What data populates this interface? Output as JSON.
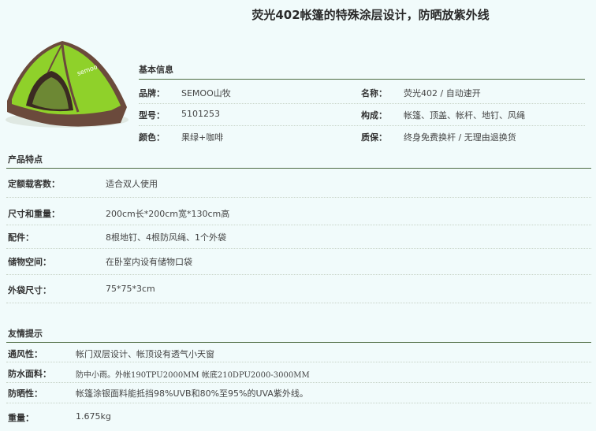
{
  "title": "荧光402帐篷的特殊涂层设计，防晒放紫外线",
  "basic_info": {
    "heading": "基本信息",
    "rows": [
      {
        "k1": "品牌：",
        "v1": "SEMOO山牧",
        "k2": "名称：",
        "v2": "荧光402 / 自动速开"
      },
      {
        "k1": "型号：",
        "v1": "5101253",
        "k2": "构成：",
        "v2": "帐篷、顶盖、帐杆、地钉、风绳"
      },
      {
        "k1": "颜色：",
        "v1": "果绿+咖啡",
        "k2": "质保：",
        "v2": "终身免费换杆 / 无理由退换货"
      }
    ]
  },
  "features": {
    "heading": "产品特点",
    "rows": [
      {
        "key": "定额载客数：",
        "value": "适合双人使用"
      },
      {
        "key": "尺寸和重量：",
        "value": "200cm长*200cm宽*130cm高"
      },
      {
        "key": "配件：",
        "value": "8根地钉、4根防风绳、1个外袋"
      },
      {
        "key": "储物空间：",
        "value": "在卧室内设有储物口袋"
      },
      {
        "key": "外袋尺寸：",
        "value": "75*75*3cm"
      }
    ]
  },
  "tips": {
    "heading": "友情提示",
    "rows": [
      {
        "key": "通风性：",
        "value": "帐门双层设计、帐顶设有透气小天窗"
      },
      {
        "key": "防水面料：",
        "value": "防中小雨。外帐190TPU2000MM 帐底210DPU2000-3000MM"
      },
      {
        "key": "防晒性：",
        "value": "帐篷涂银面料能抵挡98%UVB和80%至95%的UVA紫外线。"
      },
      {
        "key": "重量：",
        "value": "1.675kg"
      }
    ]
  },
  "colors": {
    "rule": "#4d6b42",
    "background": "#f1fbfb",
    "tent_green": "#8fd12a",
    "tent_brown": "#6b4a3c"
  }
}
